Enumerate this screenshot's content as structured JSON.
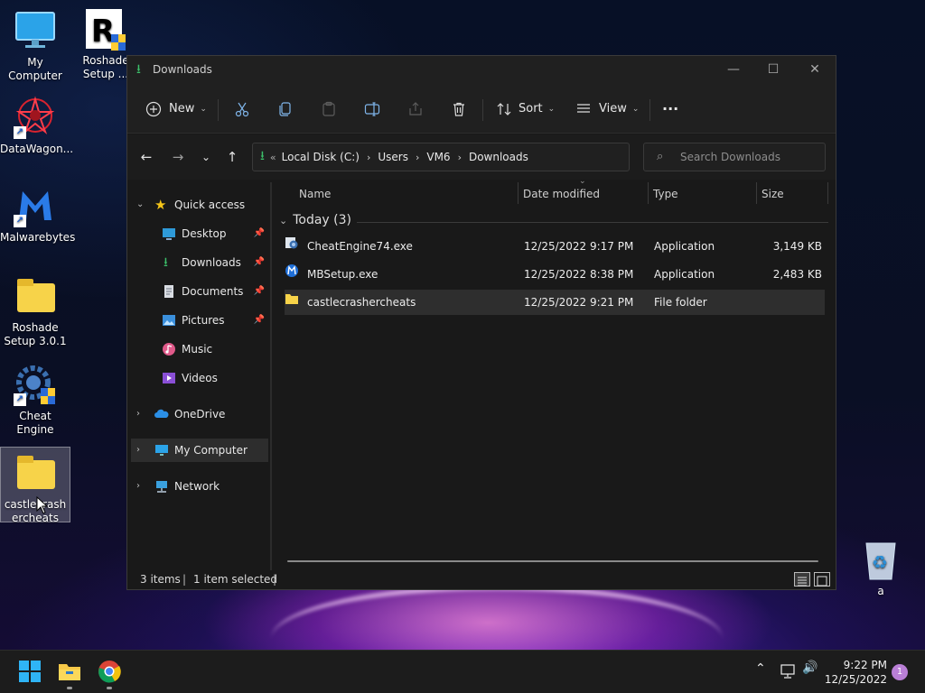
{
  "desktop": {
    "icons": [
      {
        "label": "My Computer",
        "icon": "monitor-icon"
      },
      {
        "label": "Roshade Setup ...",
        "icon": "roshade-installer-icon"
      },
      {
        "label": "DataWagon...",
        "icon": "datawagon-icon"
      },
      {
        "label": "Malwarebytes",
        "icon": "malwarebytes-icon"
      },
      {
        "label": "Roshade Setup 3.0.1",
        "icon": "folder-icon"
      },
      {
        "label": "Cheat Engine",
        "icon": "cheat-engine-icon"
      },
      {
        "label": "castlecrashercheats",
        "icon": "folder-icon"
      },
      {
        "label": "a",
        "icon": "recycle-bin-icon"
      }
    ]
  },
  "window": {
    "title": "Downloads",
    "controls": {
      "minimize": "—",
      "maximize": "☐",
      "close": "✕"
    }
  },
  "toolbar": {
    "new_label": "New",
    "sort_label": "Sort",
    "view_label": "View",
    "more_label": "···"
  },
  "address": {
    "overflow": "«",
    "crumbs": [
      "Local Disk (C:)",
      "Users",
      "VM6",
      "Downloads"
    ],
    "separator": "›"
  },
  "search": {
    "placeholder": "Search Downloads"
  },
  "sidebar": {
    "quick_access": "Quick access",
    "pinned": [
      {
        "label": "Desktop",
        "pinned": true
      },
      {
        "label": "Downloads",
        "pinned": true
      },
      {
        "label": "Documents",
        "pinned": true
      },
      {
        "label": "Pictures",
        "pinned": true
      },
      {
        "label": "Music",
        "pinned": false
      },
      {
        "label": "Videos",
        "pinned": false
      }
    ],
    "onedrive": "OneDrive",
    "my_computer": "My Computer",
    "network": "Network"
  },
  "columns": {
    "name": "Name",
    "date": "Date modified",
    "type": "Type",
    "size": "Size"
  },
  "group": {
    "label": "Today (3)"
  },
  "files": [
    {
      "name": "CheatEngine74.exe",
      "date": "12/25/2022 9:17 PM",
      "type": "Application",
      "size": "3,149 KB"
    },
    {
      "name": "MBSetup.exe",
      "date": "12/25/2022 8:38 PM",
      "type": "Application",
      "size": "2,483 KB"
    },
    {
      "name": "castlecrashercheats",
      "date": "12/25/2022 9:21 PM",
      "type": "File folder",
      "size": ""
    }
  ],
  "status": {
    "items": "3 items",
    "selected": "1 item selected"
  },
  "taskbar": {
    "time": "9:22 PM",
    "date": "12/25/2022",
    "notifications": "1"
  },
  "colors": {
    "accent": "#3cc06a",
    "folder": "#f7d349",
    "window_bg": "#191919",
    "selection": "#2e2e2e"
  }
}
